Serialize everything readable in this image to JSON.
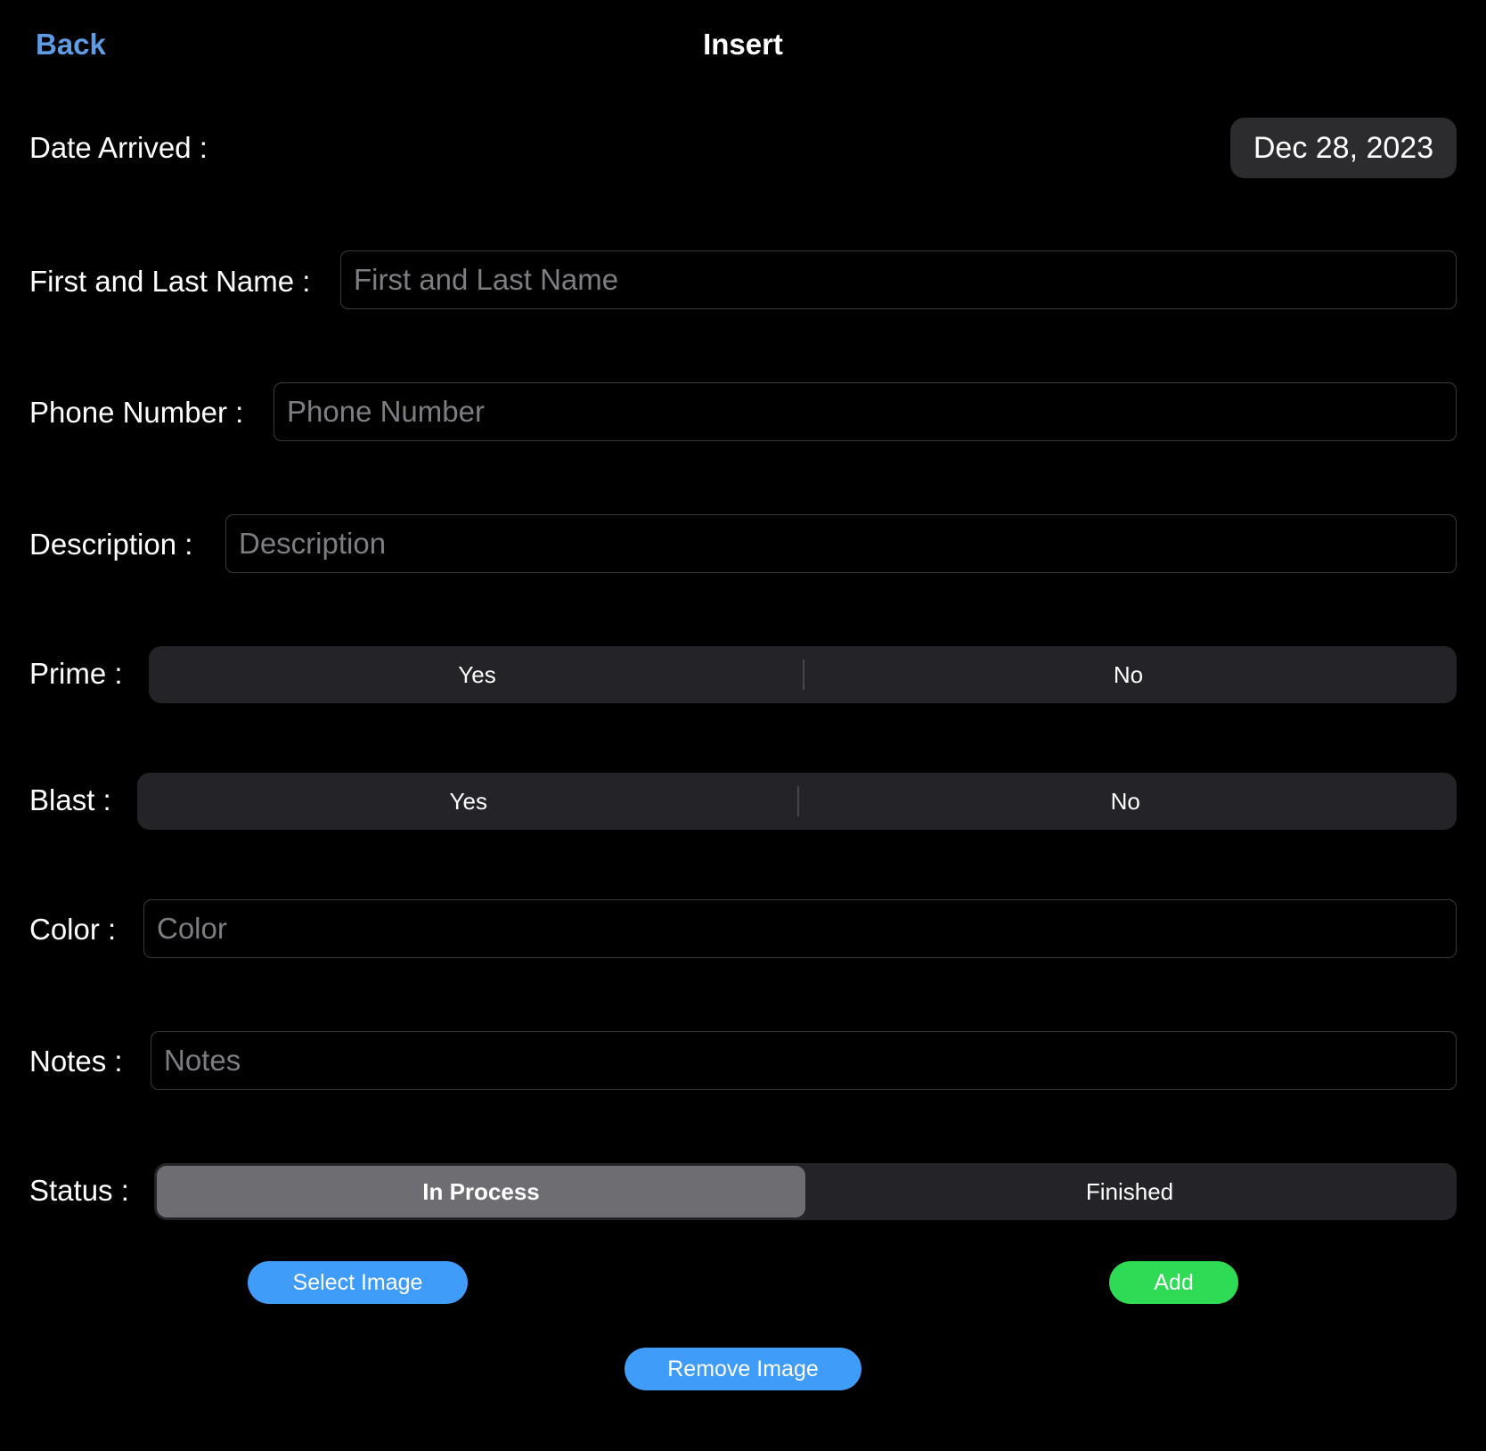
{
  "nav": {
    "back_label": "Back",
    "title": "Insert"
  },
  "form": {
    "date_arrived": {
      "label": "Date Arrived  :",
      "value": "Dec 28, 2023"
    },
    "name": {
      "label": "First and Last Name :",
      "placeholder": "First and Last Name",
      "value": ""
    },
    "phone": {
      "label": "Phone Number :",
      "placeholder": "Phone Number",
      "value": ""
    },
    "description": {
      "label": "Description :",
      "placeholder": "Description",
      "value": ""
    },
    "prime": {
      "label": "Prime :",
      "options": [
        "Yes",
        "No"
      ],
      "selected": null
    },
    "blast": {
      "label": "Blast :",
      "options": [
        "Yes",
        "No"
      ],
      "selected": null
    },
    "color": {
      "label": "Color :",
      "placeholder": "Color",
      "value": ""
    },
    "notes": {
      "label": "Notes :",
      "placeholder": "Notes",
      "value": ""
    },
    "status": {
      "label": "Status :",
      "options": [
        "In Process",
        "Finished"
      ],
      "selected": "In Process"
    }
  },
  "actions": {
    "select_image_label": "Select Image",
    "add_label": "Add",
    "remove_image_label": "Remove Image"
  },
  "colors": {
    "background": "#000000",
    "link": "#5e9de6",
    "primary_button": "#3f9cf9",
    "add_button": "#2fdb55",
    "segment_bg": "#242428",
    "segment_selected": "#6d6d72"
  }
}
